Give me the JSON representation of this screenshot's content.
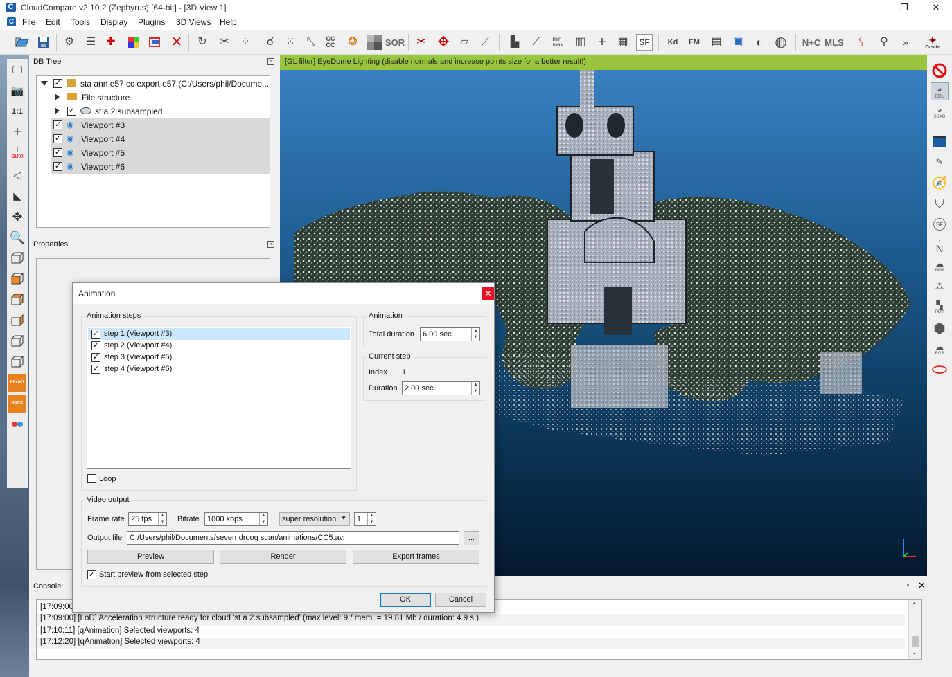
{
  "window": {
    "title": "CloudCompare v2.10.2 (Zephyrus) [64-bit] - [3D View 1]",
    "minimize": "—",
    "maximize": "❐",
    "close": "✕"
  },
  "menu": [
    "File",
    "Edit",
    "Tools",
    "Display",
    "Plugins",
    "3D Views",
    "Help"
  ],
  "toolbar": {
    "cc_label": "CC\nCC",
    "sor_label": "SOR",
    "sf_label": "SF",
    "kd_label": "Kd",
    "fm_label": "FM",
    "ntc_label": "N+C",
    "mls_label": "MLS",
    "more_label": "»",
    "canupo_label": "Create"
  },
  "left_tools": {
    "one_to_one": "1:1",
    "auto": "auto",
    "front": "FRONT",
    "back": "BACK"
  },
  "db_tree": {
    "header": "DB Tree",
    "items": [
      {
        "label": "sta ann e57 cc export.e57 (C:/Users/phil/Docume...",
        "checked": true
      },
      {
        "label": "File structure"
      },
      {
        "label": "st a 2.subsampled",
        "checked": true
      },
      {
        "label": "Viewport #3",
        "checked": true
      },
      {
        "label": "Viewport #4",
        "checked": true
      },
      {
        "label": "Viewport #5",
        "checked": true
      },
      {
        "label": "Viewport #6",
        "checked": true
      }
    ]
  },
  "properties": {
    "header": "Properties"
  },
  "view3d": {
    "gl_filter": "[GL filter] EyeDome Lighting (disable normals and increase points size for a better result!)"
  },
  "right_tools": {
    "edl": "EDL",
    "ssao": "SSAO",
    "n": "N",
    "hpr": "HPR",
    "pdv": "PDV",
    "rgb": "RGB",
    "sf": "SF"
  },
  "console": {
    "header": "Console",
    "lines": [
      "[17:09:00]",
      "[17:09:00] [LoD] Acceleration structure ready for cloud 'st a 2.subsampled' (max level: 9 / mem. = 19.81 Mb / duration: 4.9 s.)",
      "[17:10:11] [qAnimation] Selected viewports: 4",
      "[17:12:20] [qAnimation] Selected viewports: 4"
    ]
  },
  "dialog": {
    "title": "Animation",
    "close": "✕",
    "steps_group": "Animation steps",
    "steps": [
      "step 1 (Viewport #3)",
      "step 2 (Viewport #4)",
      "step 3 (Viewport #5)",
      "step 4 (Viewport #6)"
    ],
    "loop_label": "Loop",
    "animation_group": "Animation",
    "total_duration_label": "Total duration",
    "total_duration_value": "6.00 sec.",
    "current_step_group": "Current step",
    "index_label": "Index",
    "index_value": "1",
    "duration_label": "Duration",
    "duration_value": "2.00 sec.",
    "video_group": "Video output",
    "frame_rate_label": "Frame rate",
    "frame_rate_value": "25 fps",
    "bitrate_label": "Bitrate",
    "bitrate_value": "1000 kbps",
    "resolution_value": "super resolution",
    "resolution_factor": "1",
    "output_file_label": "Output file",
    "output_file_value": "C:/Users/phil/Documents/severndroog scan/animations/CC5.avi",
    "browse_label": "...",
    "preview_label": "Preview",
    "render_label": "Render",
    "export_frames_label": "Export frames",
    "start_preview_label": "Start preview from selected step",
    "ok_label": "OK",
    "cancel_label": "Cancel"
  },
  "colors": {
    "gl_bar": "#99c63c",
    "close_red": "#e81123",
    "selection": "#cce8ff",
    "accent": "#0078d7"
  }
}
